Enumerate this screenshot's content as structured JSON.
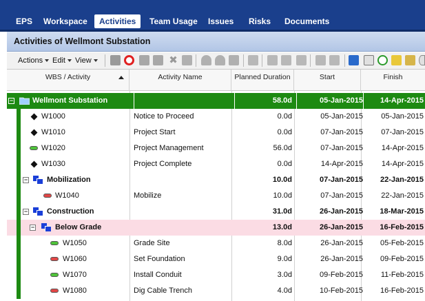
{
  "nav": {
    "tabs": [
      {
        "label": "EPS",
        "active": false
      },
      {
        "label": "Workspace",
        "active": false
      },
      {
        "label": "Activities",
        "active": true
      },
      {
        "label": "Team Usage",
        "active": false
      },
      {
        "label": "Issues",
        "active": false
      },
      {
        "label": "Risks",
        "active": false
      },
      {
        "label": "Documents",
        "active": false
      }
    ]
  },
  "page": {
    "title": "Activities of Wellmont Substation"
  },
  "toolbar": {
    "menus": [
      "Actions",
      "Edit",
      "View"
    ]
  },
  "grid": {
    "columns": [
      "WBS / Activity",
      "Activity Name",
      "Planned Duration",
      "Start",
      "Finish"
    ],
    "rows": [
      {
        "id": "Wellmont Substation",
        "name": "",
        "duration": "58.0d",
        "start": "05-Jan-2015",
        "finish": "14-Apr-2015"
      },
      {
        "id": "W1000",
        "name": "Notice to Proceed",
        "duration": "0.0d",
        "start": "05-Jan-2015",
        "finish": "05-Jan-2015"
      },
      {
        "id": "W1010",
        "name": "Project Start",
        "duration": "0.0d",
        "start": "07-Jan-2015",
        "finish": "07-Jan-2015"
      },
      {
        "id": "W1020",
        "name": "Project Management",
        "duration": "56.0d",
        "start": "07-Jan-2015",
        "finish": "14-Apr-2015"
      },
      {
        "id": "W1030",
        "name": "Project Complete",
        "duration": "0.0d",
        "start": "14-Apr-2015",
        "finish": "14-Apr-2015"
      },
      {
        "id": "Mobilization",
        "name": "",
        "duration": "10.0d",
        "start": "07-Jan-2015",
        "finish": "22-Jan-2015"
      },
      {
        "id": "W1040",
        "name": "Mobilize",
        "duration": "10.0d",
        "start": "07-Jan-2015",
        "finish": "22-Jan-2015"
      },
      {
        "id": "Construction",
        "name": "",
        "duration": "31.0d",
        "start": "26-Jan-2015",
        "finish": "18-Mar-2015"
      },
      {
        "id": "Below Grade",
        "name": "",
        "duration": "13.0d",
        "start": "26-Jan-2015",
        "finish": "16-Feb-2015"
      },
      {
        "id": "W1050",
        "name": "Grade Site",
        "duration": "8.0d",
        "start": "26-Jan-2015",
        "finish": "05-Feb-2015"
      },
      {
        "id": "W1060",
        "name": "Set Foundation",
        "duration": "9.0d",
        "start": "26-Jan-2015",
        "finish": "09-Feb-2015"
      },
      {
        "id": "W1070",
        "name": "Install Conduit",
        "duration": "3.0d",
        "start": "09-Feb-2015",
        "finish": "11-Feb-2015"
      },
      {
        "id": "W1080",
        "name": "Dig Cable Trench",
        "duration": "4.0d",
        "start": "10-Feb-2015",
        "finish": "16-Feb-2015"
      }
    ]
  },
  "colors": {
    "nav": "#1a3f8c",
    "project_row": "#1d8a12",
    "selected_wbs_row": "#fbdce4",
    "wbs_icon": "#1a3fd8"
  }
}
